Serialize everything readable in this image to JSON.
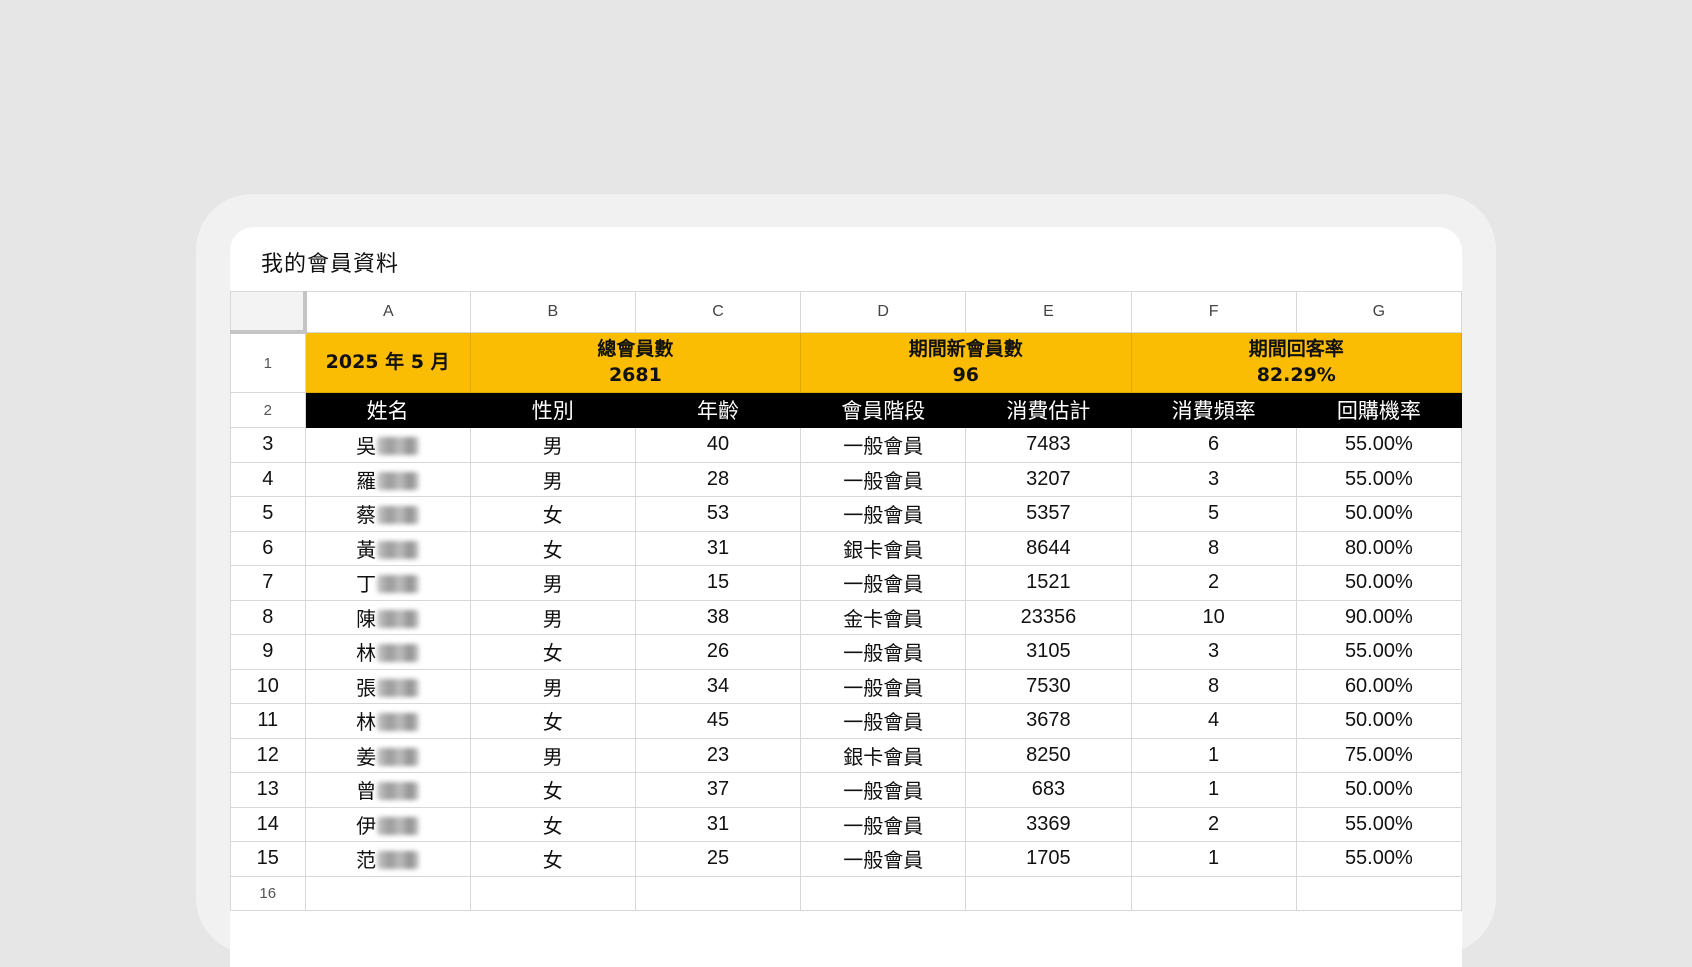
{
  "sheet": {
    "title": "我的會員資料"
  },
  "columns": [
    "A",
    "B",
    "C",
    "D",
    "E",
    "F",
    "G"
  ],
  "summary": {
    "period": "2025 年 5 月",
    "total_members_label": "總會員數",
    "total_members_value": "2681",
    "new_members_label": "期間新會員數",
    "new_members_value": "96",
    "return_rate_label": "期間回客率",
    "return_rate_value": "82.29%"
  },
  "headers": [
    "姓名",
    "性別",
    "年齡",
    "會員階段",
    "消費估計",
    "消費頻率",
    "回購機率"
  ],
  "rows": [
    {
      "num": "3",
      "surname": "吳",
      "gender": "男",
      "age": "40",
      "tier": "一般會員",
      "spend": "7483",
      "freq": "6",
      "prob": "55.00%"
    },
    {
      "num": "4",
      "surname": "羅",
      "gender": "男",
      "age": "28",
      "tier": "一般會員",
      "spend": "3207",
      "freq": "3",
      "prob": "55.00%"
    },
    {
      "num": "5",
      "surname": "蔡",
      "gender": "女",
      "age": "53",
      "tier": "一般會員",
      "spend": "5357",
      "freq": "5",
      "prob": "50.00%"
    },
    {
      "num": "6",
      "surname": "黃",
      "gender": "女",
      "age": "31",
      "tier": "銀卡會員",
      "spend": "8644",
      "freq": "8",
      "prob": "80.00%"
    },
    {
      "num": "7",
      "surname": "丁",
      "gender": "男",
      "age": "15",
      "tier": "一般會員",
      "spend": "1521",
      "freq": "2",
      "prob": "50.00%"
    },
    {
      "num": "8",
      "surname": "陳",
      "gender": "男",
      "age": "38",
      "tier": "金卡會員",
      "spend": "23356",
      "freq": "10",
      "prob": "90.00%"
    },
    {
      "num": "9",
      "surname": "林",
      "gender": "女",
      "age": "26",
      "tier": "一般會員",
      "spend": "3105",
      "freq": "3",
      "prob": "55.00%"
    },
    {
      "num": "10",
      "surname": "張",
      "gender": "男",
      "age": "34",
      "tier": "一般會員",
      "spend": "7530",
      "freq": "8",
      "prob": "60.00%"
    },
    {
      "num": "11",
      "surname": "林",
      "gender": "女",
      "age": "45",
      "tier": "一般會員",
      "spend": "3678",
      "freq": "4",
      "prob": "50.00%"
    },
    {
      "num": "12",
      "surname": "姜",
      "gender": "男",
      "age": "23",
      "tier": "銀卡會員",
      "spend": "8250",
      "freq": "1",
      "prob": "75.00%"
    },
    {
      "num": "13",
      "surname": "曾",
      "gender": "女",
      "age": "37",
      "tier": "一般會員",
      "spend": "683",
      "freq": "1",
      "prob": "50.00%"
    },
    {
      "num": "14",
      "surname": "伊",
      "gender": "女",
      "age": "31",
      "tier": "一般會員",
      "spend": "3369",
      "freq": "2",
      "prob": "55.00%"
    },
    {
      "num": "15",
      "surname": "范",
      "gender": "女",
      "age": "25",
      "tier": "一般會員",
      "spend": "1705",
      "freq": "1",
      "prob": "55.00%"
    }
  ],
  "row_numbers": {
    "summary": "1",
    "header": "2",
    "next": "16"
  },
  "colors": {
    "background": "#e6e6e6",
    "frame": "#f1f1f1",
    "summary_fill": "#fbbc04",
    "header_fill": "#000000",
    "grid_line": "#d7d7d7"
  }
}
